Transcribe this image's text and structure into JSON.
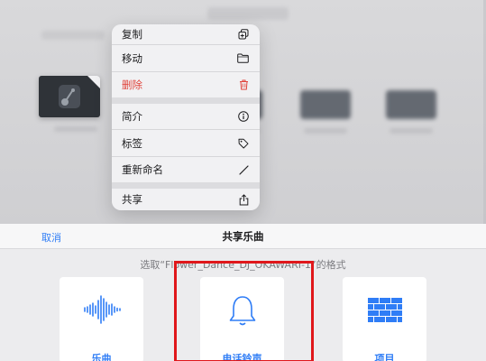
{
  "menu": {
    "items": [
      {
        "label": "复制",
        "icon": "duplicate-icon"
      },
      {
        "label": "移动",
        "icon": "folder-icon"
      },
      {
        "label": "删除",
        "icon": "trash-icon",
        "color": "#e0423a"
      },
      {
        "label": "简介",
        "icon": "info-icon"
      },
      {
        "label": "标签",
        "icon": "tag-icon"
      },
      {
        "label": "重新命名",
        "icon": "pencil-icon"
      },
      {
        "label": "共享",
        "icon": "share-icon"
      }
    ]
  },
  "sheet": {
    "cancel_label": "取消",
    "title": "共享乐曲",
    "subtitle": "选取“Flower_Dance_DJ_OKAWARI-1”的格式",
    "options": [
      {
        "label": "乐曲",
        "icon": "waveform-icon"
      },
      {
        "label": "电话铃声",
        "icon": "bell-icon"
      },
      {
        "label": "项目",
        "icon": "bricks-icon"
      }
    ]
  },
  "colors": {
    "accent": "#2f7df6",
    "danger": "#e0423a",
    "highlight": "#e0171b"
  }
}
